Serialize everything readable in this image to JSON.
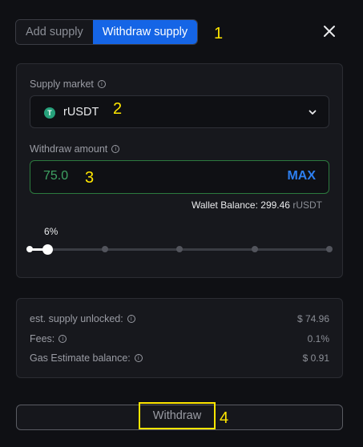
{
  "tabs": [
    {
      "label": "Add supply",
      "active": false
    },
    {
      "label": "Withdraw supply",
      "active": true
    }
  ],
  "annotations": [
    "1",
    "2",
    "3",
    "4"
  ],
  "close_icon": "close-icon",
  "supply_market": {
    "label": "Supply market",
    "selected": "rUSDT",
    "coin_icon": "tether-coin-icon",
    "coin_glyph": "T"
  },
  "withdraw_amount": {
    "label": "Withdraw amount",
    "value": "75.0",
    "max_label": "MAX"
  },
  "wallet": {
    "label": "Wallet Balance:",
    "amount": "299.46",
    "unit": "rUSDT"
  },
  "slider": {
    "percent_label": "6%",
    "value_fraction": 0.06
  },
  "summary": [
    {
      "label": "est. supply unlocked:",
      "value": "$ 74.96",
      "info": true
    },
    {
      "label": "Fees:",
      "value": "0.1%",
      "info": true
    },
    {
      "label": "Gas Estimate balance:",
      "value": "$ 0.91",
      "info": true
    }
  ],
  "submit": {
    "label": "Withdraw"
  },
  "colors": {
    "accent": "#1565e6",
    "input_border": "#2c7a3e",
    "input_text": "#3fa363",
    "max": "#2d7ff0",
    "highlight": "#ffe600"
  }
}
